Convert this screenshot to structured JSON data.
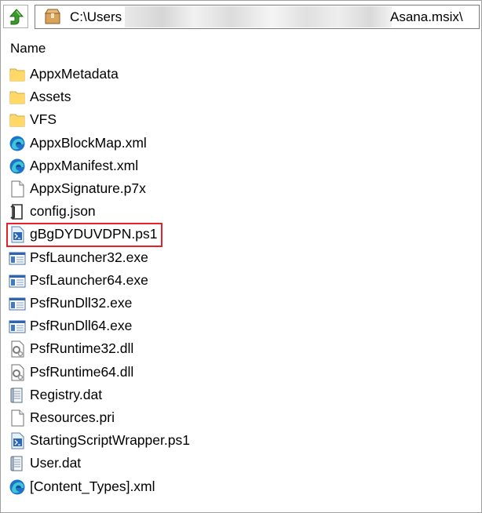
{
  "address": {
    "path_start": "C:\\Users",
    "path_end": "Asana.msix\\"
  },
  "header": {
    "name_column": "Name"
  },
  "files": [
    {
      "name": "AppxMetadata",
      "icon": "folder-icon"
    },
    {
      "name": "Assets",
      "icon": "folder-icon"
    },
    {
      "name": "VFS",
      "icon": "folder-icon"
    },
    {
      "name": "AppxBlockMap.xml",
      "icon": "edge-icon"
    },
    {
      "name": "AppxManifest.xml",
      "icon": "edge-icon"
    },
    {
      "name": "AppxSignature.p7x",
      "icon": "file-icon"
    },
    {
      "name": "config.json",
      "icon": "json-icon"
    },
    {
      "name": "gBgDYDUVDPN.ps1",
      "icon": "powershell-script-icon",
      "highlighted": true
    },
    {
      "name": "PsfLauncher32.exe",
      "icon": "exe-icon"
    },
    {
      "name": "PsfLauncher64.exe",
      "icon": "exe-icon"
    },
    {
      "name": "PsfRunDll32.exe",
      "icon": "exe-icon"
    },
    {
      "name": "PsfRunDll64.exe",
      "icon": "exe-icon"
    },
    {
      "name": "PsfRuntime32.dll",
      "icon": "dll-icon"
    },
    {
      "name": "PsfRuntime64.dll",
      "icon": "dll-icon"
    },
    {
      "name": "Registry.dat",
      "icon": "dat-icon"
    },
    {
      "name": "Resources.pri",
      "icon": "file-icon"
    },
    {
      "name": "StartingScriptWrapper.ps1",
      "icon": "powershell-script-icon"
    },
    {
      "name": "User.dat",
      "icon": "dat-icon"
    },
    {
      "name": "[Content_Types].xml",
      "icon": "edge-icon"
    }
  ],
  "colors": {
    "highlight": "#e5222a",
    "folder": "#ffd866"
  }
}
